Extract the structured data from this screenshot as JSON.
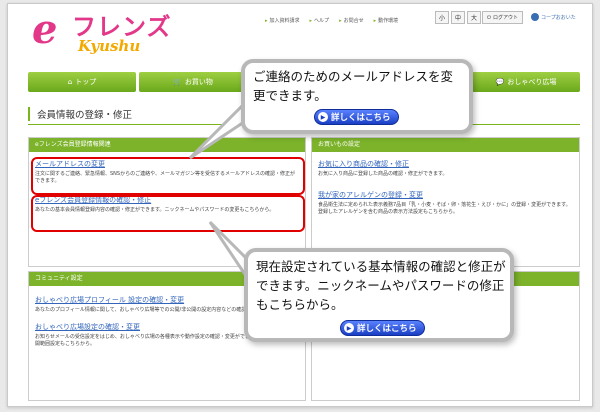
{
  "header": {
    "logo_e": "e",
    "logo_friends": "フレンズ",
    "logo_kyushu": "Kyushu",
    "links": [
      "加入資料請求",
      "ヘルプ",
      "お問合せ",
      "動作環境"
    ],
    "font_sizes": [
      "小",
      "中",
      "大"
    ],
    "logout": "ログアウト",
    "coop": "コープおおいた"
  },
  "nav": [
    {
      "icon": "home-icon",
      "label": "トップ"
    },
    {
      "icon": "cart-icon",
      "label": "お買い物"
    },
    {
      "icon": "",
      "label": ""
    },
    {
      "icon": "",
      "label": ""
    },
    {
      "icon": "chat-icon",
      "label": "おしゃべり広場"
    }
  ],
  "page_title": "会員情報の登録・修正",
  "panels": {
    "member": {
      "header": "eフレンズ会員登録情報関連",
      "entries": [
        {
          "link": "メールアドレスの変更",
          "desc": "注文に関するご連絡、緊急情報、SNSからのご連絡や、メールマガジン等を受信するメールアドレスの確認・修正ができます。"
        },
        {
          "link": "eフレンズ会員登録情報の確認・修正",
          "desc": "あなたの基本会員情報登録内容の確認・修正ができます。ニックネームやパスワードの変更もこちらから。"
        }
      ]
    },
    "shopping": {
      "header": "お買いもの設定",
      "entries": [
        {
          "link": "お気に入り商品の確認・修正",
          "desc": "お気に入り商品に登録した商品の確認・修正ができます。"
        },
        {
          "link": "我が家のアレルゲンの登録・変更",
          "desc": "食品衛生法に定められた表示義務7品目「乳・小麦・そば・卵・落花生・えび・かに」の登録・変更ができます。登録したアレルゲンを含む商品の表示方法設定もこちらから。"
        }
      ]
    },
    "community": {
      "header": "コミュニティ設定",
      "entries": [
        {
          "link": "おしゃべり広場プロフィール 設定の確認・変更",
          "desc": "あなたのプロフィール情報に関して、おしゃべり広場等での公開/非公開の設定内容などの確認・変更ができます。"
        },
        {
          "link": "おしゃべり広場設定の確認・変更",
          "desc": "お知らせメールの受信設定をはじめ、おしゃべり広場の各種表示や動作設定の確認・変更ができます。日記などの公開範囲設定もこちらから。"
        }
      ]
    }
  },
  "callouts": {
    "mail": {
      "text": "ご連絡のためのメールアドレスを変更できます。",
      "button": "詳しくはこちら"
    },
    "info": {
      "text": "現在設定されている基本情報の確認と修正ができます。ニックネームやパスワードの修正もこちらから。",
      "button": "詳しくはこちら"
    }
  },
  "colors": {
    "brand_pink": "#e3388a",
    "brand_green": "#7ab51d",
    "highlight_red": "#e00000",
    "button_blue": "#1a3fc4"
  }
}
